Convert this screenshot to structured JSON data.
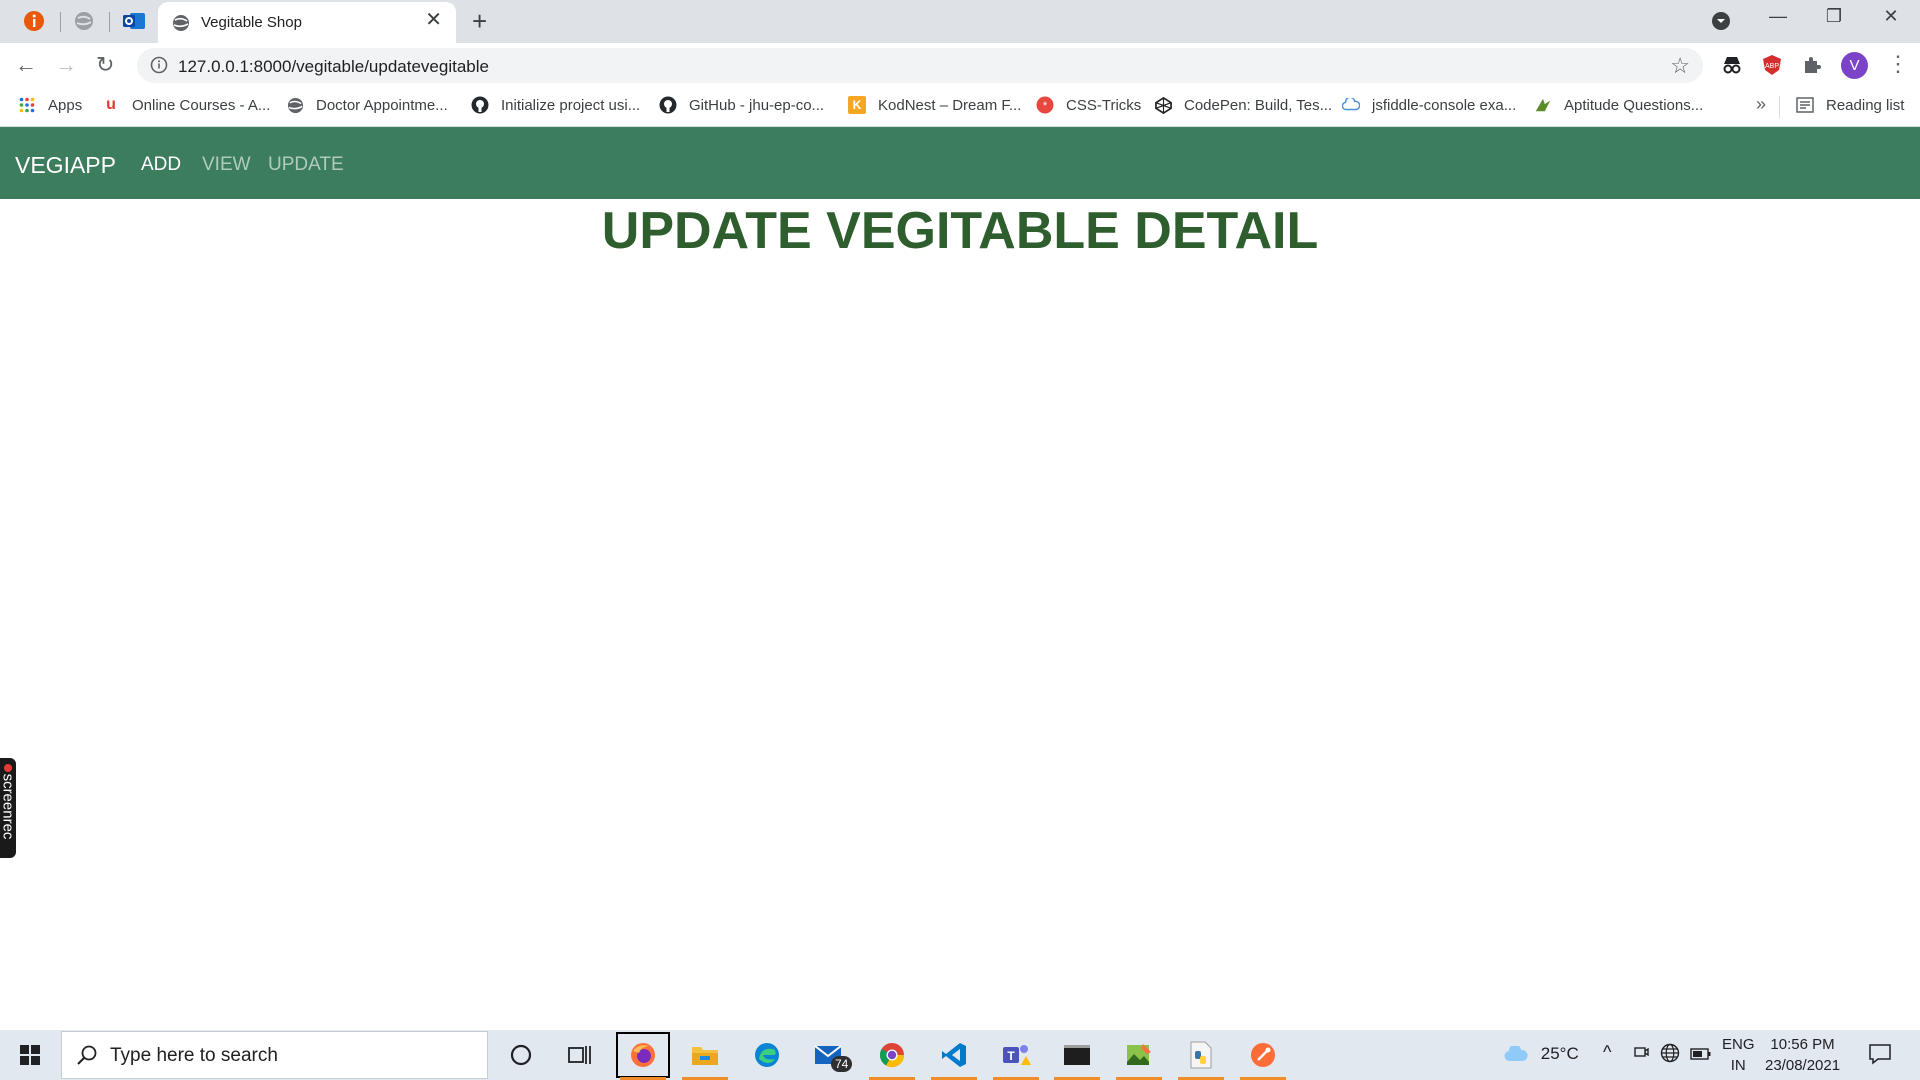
{
  "browser": {
    "tab_title": "Vegitable Shop",
    "tab_close": "✕",
    "new_tab": "+",
    "url": "127.0.0.1:8000/vegitable/updatevegitable",
    "window_controls": {
      "minimize": "—",
      "restore": "❐",
      "close": "✕"
    },
    "bookmarks": [
      {
        "label": "Apps",
        "icon": "apps-grid-icon"
      },
      {
        "label": "Online Courses - A...",
        "icon": "udemy-icon"
      },
      {
        "label": "Doctor Appointme...",
        "icon": "globe-icon"
      },
      {
        "label": "Initialize project usi...",
        "icon": "github-icon"
      },
      {
        "label": "GitHub - jhu-ep-co...",
        "icon": "github-icon"
      },
      {
        "label": "KodNest – Dream F...",
        "icon": "kodnest-icon"
      },
      {
        "label": "CSS-Tricks",
        "icon": "css-tricks-icon"
      },
      {
        "label": "CodePen: Build, Tes...",
        "icon": "codepen-icon"
      },
      {
        "label": "jsfiddle-console exa...",
        "icon": "jsfiddle-icon"
      },
      {
        "label": "Aptitude Questions...",
        "icon": "aptitude-icon"
      }
    ],
    "bookmarks_more": "»",
    "reading_list": "Reading list",
    "profile_initial": "V"
  },
  "app": {
    "brand": "VEGIAPP",
    "nav": [
      {
        "label": "ADD",
        "active": true
      },
      {
        "label": "VIEW",
        "active": false
      },
      {
        "label": "UPDATE",
        "active": false
      }
    ],
    "heading": "UPDATE VEGITABLE DETAIL",
    "navbar_color": "#3b7d5d",
    "heading_color": "#2e5e2e"
  },
  "overlay": {
    "screenrec_label": "screenrec"
  },
  "taskbar": {
    "search_placeholder": "Type here to search",
    "mail_badge": "74",
    "weather": "25°C",
    "lang_line1": "ENG",
    "lang_line2": "IN",
    "time": "10:56 PM",
    "date": "23/08/2021"
  }
}
